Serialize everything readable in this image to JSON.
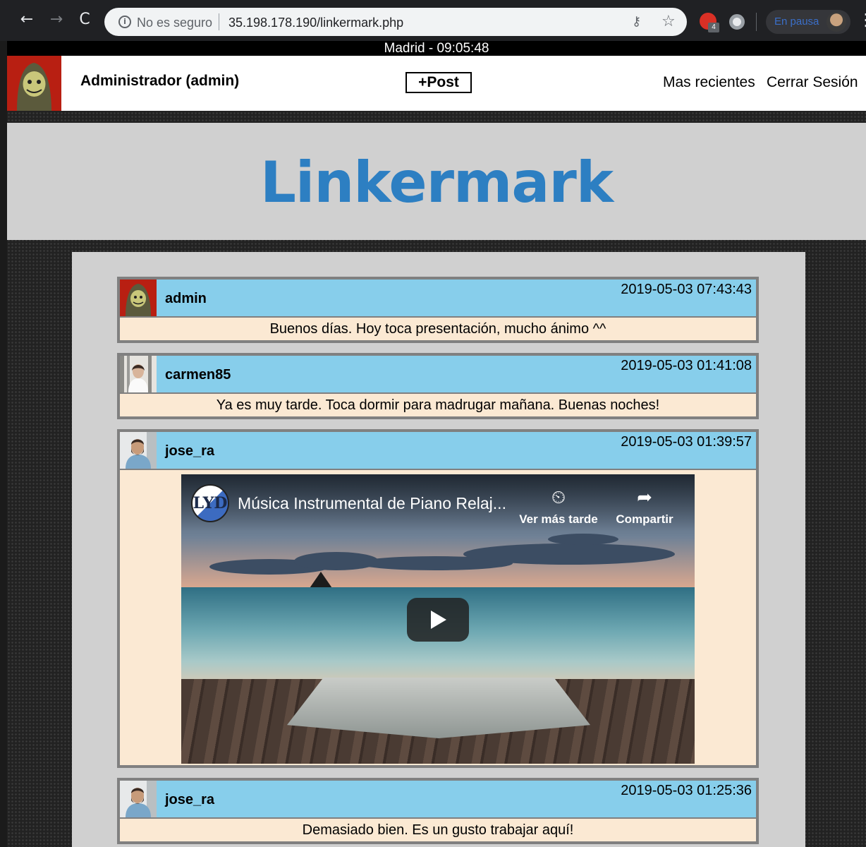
{
  "browser": {
    "insecure_label": "No es seguro",
    "url": "35.198.178.190/linkermark.php",
    "profile_status": "En pausa"
  },
  "clock": "Madrid - 09:05:48",
  "header": {
    "user": "Administrador (admin)",
    "post_button": "+Post",
    "recent_link": "Mas recientes",
    "logout_link": "Cerrar Sesión"
  },
  "brand": "Linkermark",
  "posts": [
    {
      "user": "admin",
      "date": "2019-05-03 07:43:43",
      "text": "Buenos días. Hoy toca presentación, mucho ánimo ^^"
    },
    {
      "user": "carmen85",
      "date": "2019-05-03 01:41:08",
      "text": "Ya es muy tarde. Toca dormir para madrugar mañana. Buenas noches!"
    },
    {
      "user": "jose_ra",
      "date": "2019-05-03 01:39:57",
      "video": {
        "channel": "LYD",
        "title": "Música Instrumental de Piano Relaj...",
        "watch_later": "Ver más tarde",
        "share": "Compartir"
      }
    },
    {
      "user": "jose_ra",
      "date": "2019-05-03 01:25:36",
      "text": "Demasiado bien. Es un gusto trabajar aquí!"
    }
  ],
  "colors": {
    "header_bg": "#87ceeb",
    "body_bg": "#fbe9d3",
    "logo": "#2d7fc2",
    "banner_bg": "#d0d0d0"
  }
}
